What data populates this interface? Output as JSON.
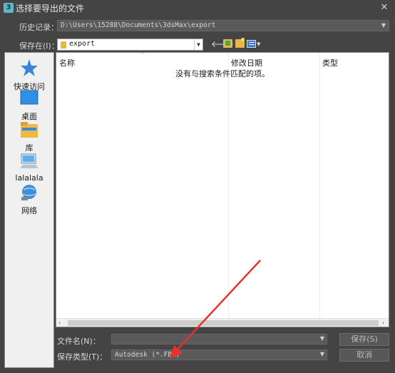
{
  "window": {
    "app_icon_label": "3",
    "title": "选择要导出的文件",
    "close_glyph": "✕"
  },
  "history": {
    "label": "历史记录：",
    "value": "D:\\Users\\15288\\Documents\\3dsMax\\export"
  },
  "save_in": {
    "label": "保存在(I)：",
    "value": "export"
  },
  "places": [
    {
      "label": "快速访问",
      "icon": "star-icon"
    },
    {
      "label": "桌面",
      "icon": "desktop-icon"
    },
    {
      "label": "库",
      "icon": "library-icon"
    },
    {
      "label": "lalalala",
      "icon": "computer-icon"
    },
    {
      "label": "网络",
      "icon": "network-icon"
    }
  ],
  "file_list": {
    "columns": [
      "名称",
      "修改日期",
      "类型"
    ],
    "empty_message": "没有与搜索条件匹配的项。"
  },
  "filename": {
    "label": "文件名(N)：",
    "value": ""
  },
  "filetype": {
    "label": "保存类型(T)：",
    "value": "Autodesk (*.FBX)"
  },
  "buttons": {
    "save": "保存(S)",
    "cancel": "取消"
  },
  "colors": {
    "background": "#444444",
    "annotation_arrow": "#e8312a"
  }
}
